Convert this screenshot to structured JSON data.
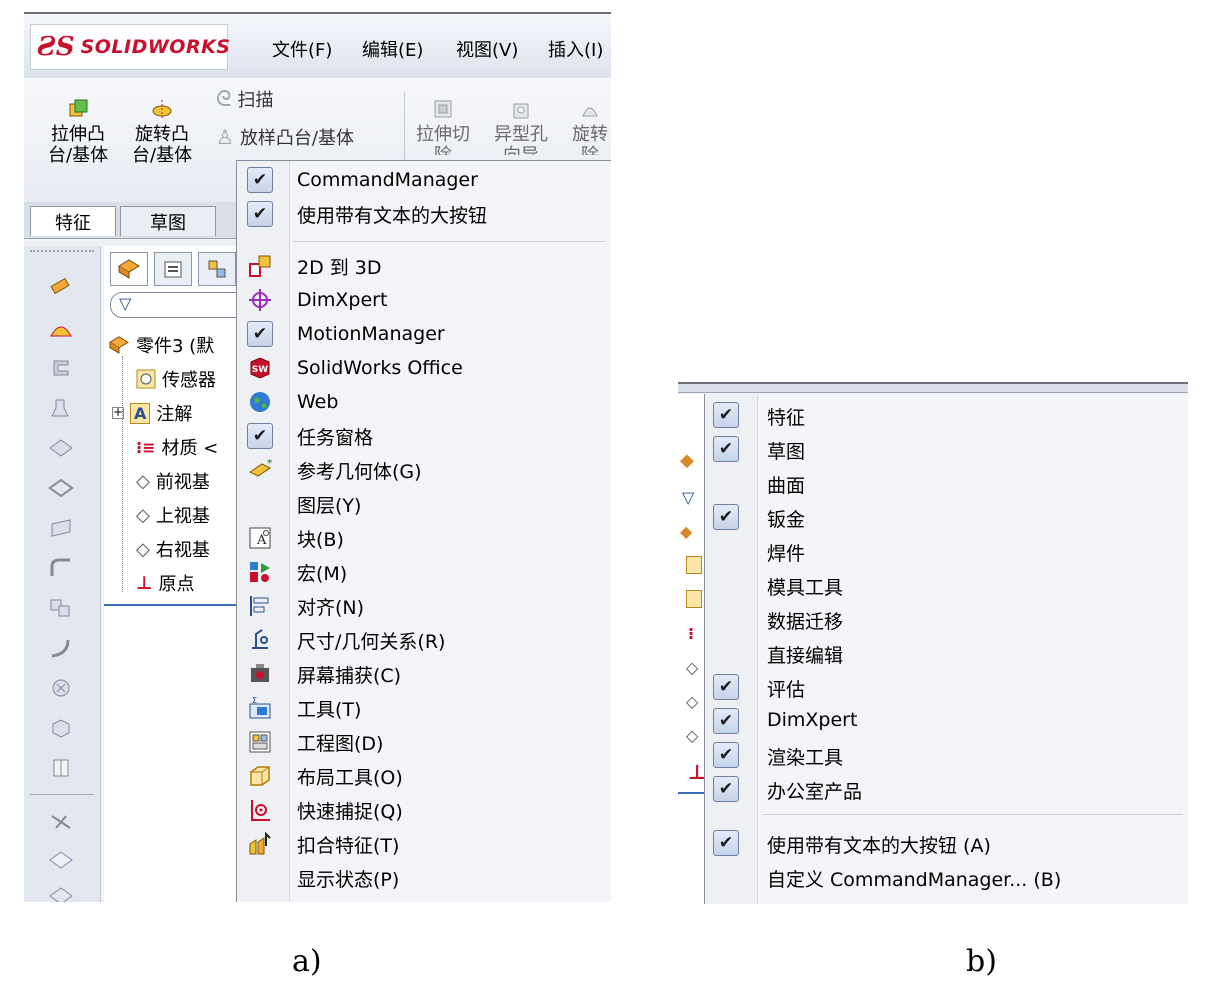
{
  "panel_a": {
    "logo": {
      "ds": "ƧS",
      "text": "SOLIDWORKS"
    },
    "menu": [
      "文件(F)",
      "编辑(E)",
      "视图(V)",
      "插入(I)"
    ],
    "ribbon": {
      "extrude_boss": [
        "拉伸凸",
        "台/基体"
      ],
      "revolve_boss": [
        "旋转凸",
        "台/基体"
      ],
      "sweep": "扫描",
      "loft": "放样凸台/基体",
      "extrude_cut": [
        "拉伸切",
        "除"
      ],
      "hole_wizard": [
        "异型孔",
        "向导"
      ],
      "revolve_cut": [
        "旋转",
        "除"
      ]
    },
    "tabs": [
      "特征",
      "草图"
    ],
    "tree": {
      "part": "零件3 (默",
      "sensors": "传感器",
      "annotations": "注解",
      "material": "材质 <",
      "front": "前视基",
      "top": "上视基",
      "right": "右视基",
      "origin": "原点"
    },
    "context_menu": [
      {
        "label": "CommandManager",
        "checked": true,
        "icon": "check"
      },
      {
        "label": "使用带有文本的大按钮",
        "checked": true,
        "icon": "check"
      },
      {
        "separator": true
      },
      {
        "label": "2D 到 3D",
        "icon": "2d-to-3d-icon"
      },
      {
        "label": "DimXpert",
        "icon": "dimxpert-icon"
      },
      {
        "label": "MotionManager",
        "checked": true,
        "icon": "check"
      },
      {
        "label": "SolidWorks Office",
        "icon": "sw-office-icon"
      },
      {
        "label": "Web",
        "icon": "globe-icon"
      },
      {
        "label": "任务窗格",
        "checked": true,
        "icon": "check"
      },
      {
        "label": "参考几何体(G)",
        "icon": "ref-geometry-icon"
      },
      {
        "label": "图层(Y)",
        "icon": ""
      },
      {
        "label": "块(B)",
        "icon": "block-icon"
      },
      {
        "label": "宏(M)",
        "icon": "macro-icon"
      },
      {
        "label": "对齐(N)",
        "icon": "align-icon"
      },
      {
        "label": "尺寸/几何关系(R)",
        "icon": "dimension-icon"
      },
      {
        "label": "屏幕捕获(C)",
        "icon": "screen-capture-icon"
      },
      {
        "label": "工具(T)",
        "icon": "tools-icon"
      },
      {
        "label": "工程图(D)",
        "icon": "drawing-icon"
      },
      {
        "label": "布局工具(O)",
        "icon": "layout-icon"
      },
      {
        "label": "快速捕捉(Q)",
        "icon": "quick-snap-icon"
      },
      {
        "label": "扣合特征(T)",
        "icon": "fastening-icon"
      },
      {
        "label": "显示状态(P)",
        "icon": ""
      }
    ]
  },
  "panel_b": {
    "menu": [
      {
        "label": "特征",
        "checked": true
      },
      {
        "label": "草图",
        "checked": true
      },
      {
        "label": "曲面",
        "checked": false
      },
      {
        "label": "钣金",
        "checked": true
      },
      {
        "label": "焊件",
        "checked": false
      },
      {
        "label": "模具工具",
        "checked": false
      },
      {
        "label": "数据迁移",
        "checked": false
      },
      {
        "label": "直接编辑",
        "checked": false
      },
      {
        "label": "评估",
        "checked": true
      },
      {
        "label": "DimXpert",
        "checked": true
      },
      {
        "label": "渲染工具",
        "checked": true
      },
      {
        "label": "办公室产品",
        "checked": true
      }
    ],
    "bottom": [
      {
        "label": "使用带有文本的大按钮 (A)",
        "checked": true
      },
      {
        "label": "自定义 CommandManager... (B)",
        "checked": false
      }
    ]
  },
  "captions": {
    "a": "a)",
    "b": "b)"
  },
  "check_glyph": "✔"
}
